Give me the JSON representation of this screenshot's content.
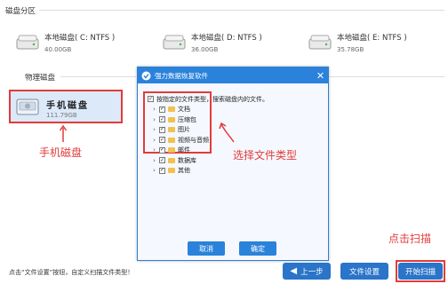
{
  "sections": {
    "disk_partitions": "磁盘分区",
    "physical_disks": "物理磁盘"
  },
  "disks": [
    {
      "name": "本地磁盘( C: NTFS )",
      "size": "40.00GB"
    },
    {
      "name": "本地磁盘( D: NTFS )",
      "size": "36.00GB"
    },
    {
      "name": "本地磁盘( E: NTFS )",
      "size": "35.78GB"
    }
  ],
  "physical": {
    "name": "手机磁盘",
    "size": "111.79GB"
  },
  "dialog": {
    "title": "强力数据恢复软件",
    "close": "✕",
    "search_option": "按指定的文件类型，搜索磁盘内的文件。",
    "file_types": [
      "文档",
      "压缩包",
      "图片",
      "视频与音频",
      "邮件",
      "数据库",
      "其他"
    ],
    "cancel": "取消",
    "ok": "确定"
  },
  "annotations": {
    "phone_disk": "手机磁盘",
    "select_type": "选择文件类型",
    "start_scan": "点击扫描"
  },
  "bottom": {
    "hint": "点击“文件设置”按钮，自定义扫描文件类型！",
    "prev": "上一步",
    "file_settings": "文件设置",
    "start_scan": "开始扫描"
  },
  "colors": {
    "accent": "#2a82db",
    "highlight": "#e23b3b",
    "selected_bg": "#dbe9f8"
  }
}
